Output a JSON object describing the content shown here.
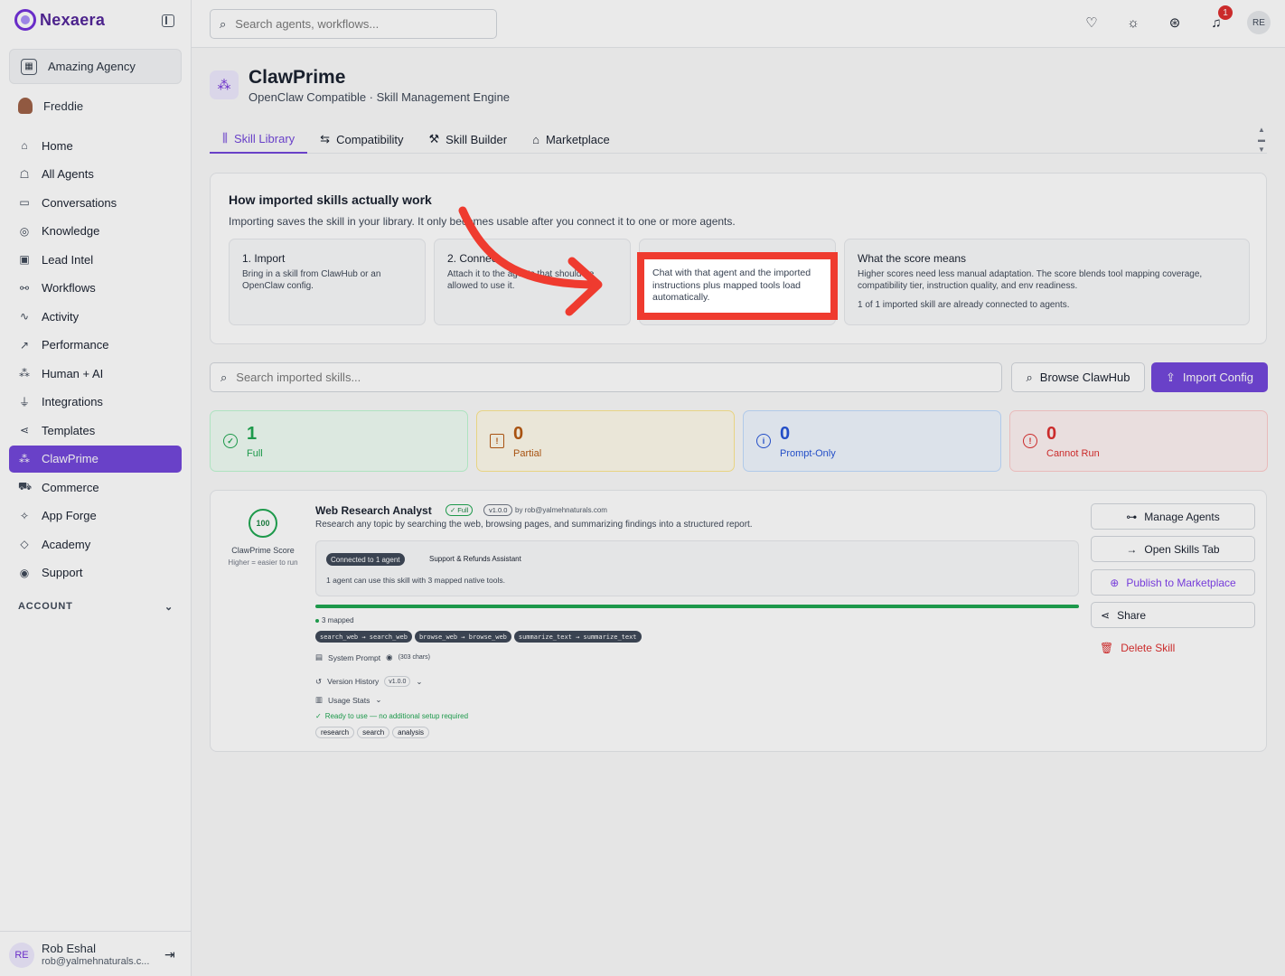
{
  "app": {
    "logo": "Nexaera",
    "org_name": "Amazing Agency",
    "user_name": "Freddie"
  },
  "sidebar": {
    "items": [
      {
        "label": "Home",
        "icon": "home-icon"
      },
      {
        "label": "All Agents",
        "icon": "robot-icon"
      },
      {
        "label": "Conversations",
        "icon": "chat-icon"
      },
      {
        "label": "Knowledge",
        "icon": "brain-icon"
      },
      {
        "label": "Lead Intel",
        "icon": "contact-icon"
      },
      {
        "label": "Workflows",
        "icon": "workflow-icon"
      },
      {
        "label": "Activity",
        "icon": "activity-icon"
      },
      {
        "label": "Performance",
        "icon": "trend-icon"
      },
      {
        "label": "Human + AI",
        "icon": "network-icon"
      },
      {
        "label": "Integrations",
        "icon": "plug-icon"
      },
      {
        "label": "Templates",
        "icon": "share-icon"
      },
      {
        "label": "ClawPrime",
        "icon": "clawprime-icon",
        "active": true
      },
      {
        "label": "Commerce",
        "icon": "cart-icon"
      },
      {
        "label": "App Forge",
        "icon": "sparkles-icon"
      },
      {
        "label": "Academy",
        "icon": "graduation-icon"
      },
      {
        "label": "Support",
        "icon": "lifebuoy-icon"
      }
    ],
    "account_label": "ACCOUNT",
    "footer": {
      "initials": "RE",
      "name": "Rob Eshal",
      "email": "rob@yalmehnaturals.c..."
    }
  },
  "topbar": {
    "search_placeholder": "Search agents, workflows...",
    "notification_count": "1",
    "avatar_initials": "RE"
  },
  "page": {
    "title": "ClawPrime",
    "subtitle": "OpenClaw Compatible · Skill Management Engine",
    "tabs": [
      {
        "label": "Skill Library",
        "icon": "library-icon",
        "active": true
      },
      {
        "label": "Compatibility",
        "icon": "compare-icon"
      },
      {
        "label": "Skill Builder",
        "icon": "wrench-icon"
      },
      {
        "label": "Marketplace",
        "icon": "store-icon"
      }
    ]
  },
  "how": {
    "title": "How imported skills actually work",
    "desc": "Importing saves the skill in your library. It only becomes usable after you connect it to one or more agents.",
    "steps": [
      {
        "title": "1. Import",
        "body": "Bring in a skill from ClawHub or an OpenClaw config."
      },
      {
        "title": "2. Connect",
        "body": "Attach it to the agents that should be allowed to use it."
      },
      {
        "title": "",
        "body": "Chat with that agent and the imported instructions plus mapped tools load automatically."
      },
      {
        "title": "What the score means",
        "body": "Higher scores need less manual adaptation. The score blends tool mapping coverage, compatibility tier, instruction quality, and env readiness.",
        "note": "1 of 1 imported skill are already connected to agents."
      }
    ]
  },
  "library": {
    "search_placeholder": "Search imported skills...",
    "browse_label": "Browse ClawHub",
    "import_label": "Import Config"
  },
  "stats": [
    {
      "value": "1",
      "label": "Full",
      "color": "#16a34a"
    },
    {
      "value": "0",
      "label": "Partial",
      "color": "#b45309"
    },
    {
      "value": "0",
      "label": "Prompt-Only",
      "color": "#1d4ed8"
    },
    {
      "value": "0",
      "label": "Cannot Run",
      "color": "#dc2626"
    }
  ],
  "skill": {
    "score": "100",
    "score_label": "ClawPrime Score",
    "score_sub": "Higher = easier to run",
    "name": "Web Research Analyst",
    "badge": "Full",
    "version": "v1.0.0",
    "author": "by rob@yalmehnaturals.com",
    "desc": "Research any topic by searching the web, browsing pages, and summarizing findings into a structured report.",
    "connected_pill": "Connected to 1 agent",
    "connected_agent": "Support & Refunds Assistant",
    "connected_note": "1 agent can use this skill with 3 mapped native tools.",
    "mapping_progress": 1.0,
    "mapped_label": "3 mapped",
    "tools": [
      "search_web → search_web",
      "browse_web → browse_web",
      "summarize_text → summarize_text"
    ],
    "system_prompt_label": "System Prompt",
    "system_prompt_chars": "(303 chars)",
    "version_history_label": "Version History",
    "version_history_value": "v1.0.0",
    "usage_stats_label": "Usage Stats",
    "ready_label": "Ready to use — no additional setup required",
    "tags": [
      "research",
      "search",
      "analysis"
    ],
    "actions": {
      "manage": "Manage Agents",
      "open": "Open Skills Tab",
      "publish": "Publish to Marketplace",
      "share": "Share",
      "delete": "Delete Skill"
    }
  },
  "colors": {
    "accent": "#6d3fd9",
    "highlight": "#ef3b2f",
    "success": "#16a34a"
  }
}
